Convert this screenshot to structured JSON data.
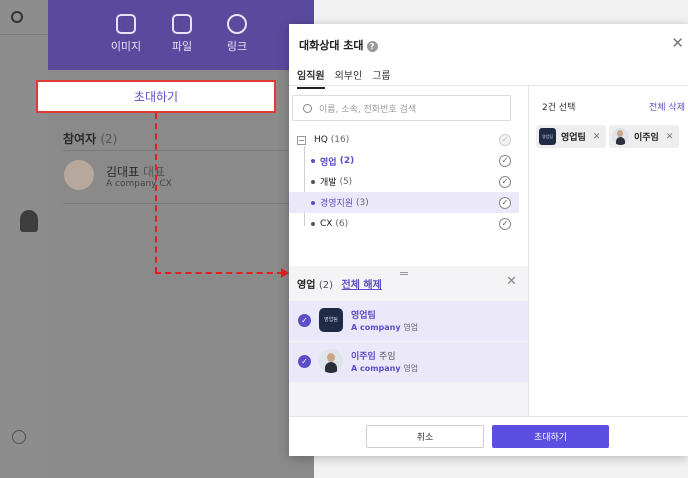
{
  "background": {
    "attachments": [
      {
        "label": "이미지",
        "icon": "image-icon"
      },
      {
        "label": "파일",
        "icon": "file-icon"
      },
      {
        "label": "링크",
        "icon": "link-icon"
      }
    ],
    "invite_button": "초대하기",
    "participants_label": "참여자",
    "participants_count": "(2)",
    "participant": {
      "name": "김대표",
      "title": "대표",
      "company": "A company CX"
    }
  },
  "modal": {
    "title": "대화상대 초대",
    "tabs": [
      "임직원",
      "외부인",
      "그룹"
    ],
    "search_placeholder": "이름, 소속, 전화번호 검색",
    "tree": [
      {
        "name": "HQ",
        "count": "(16)"
      },
      {
        "name": "영업",
        "count": "(2)"
      },
      {
        "name": "개발",
        "count": "(5)"
      },
      {
        "name": "경영지원",
        "count": "(3)"
      },
      {
        "name": "CX",
        "count": "(6)"
      }
    ],
    "sub_panel": {
      "title": "영업",
      "count": "(2)",
      "clear_link": "전체 해제",
      "members": [
        {
          "name": "영업팀",
          "title": "",
          "company": "A company",
          "dept": "영업",
          "logo_text": "영업팀"
        },
        {
          "name": "이주임",
          "title": "주임",
          "company": "A company",
          "dept": "영업"
        }
      ]
    },
    "selected_count": "2건 선택",
    "clear_all": "전체 삭제",
    "chips": [
      {
        "label": "영업팀",
        "logo_text": "영업팀"
      },
      {
        "label": "이주임"
      }
    ],
    "cancel_label": "취소",
    "confirm_label": "초대하기"
  },
  "colors": {
    "accent": "#5b4ec7",
    "header": "#5a4a9e",
    "highlight": "#ebe8fa",
    "annotation": "#e02020"
  }
}
